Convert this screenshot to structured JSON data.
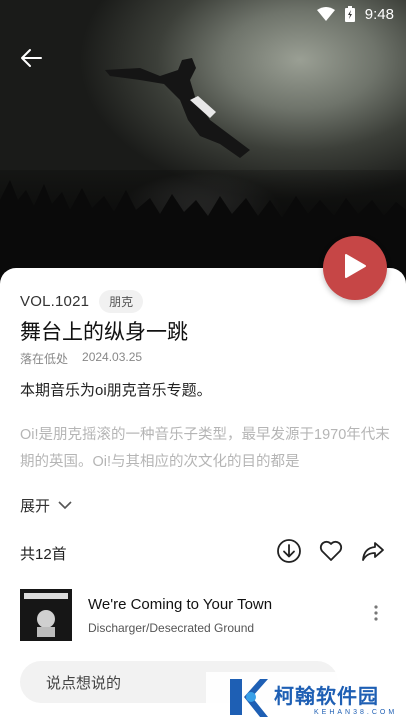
{
  "status_bar": {
    "time": "9:48"
  },
  "episode": {
    "vol": "VOL.1021",
    "tag": "朋克",
    "title": "舞台上的纵身一跳",
    "author": "落在低处",
    "date": "2024.03.25",
    "subtitle": "本期音乐为oi朋克音乐专题。",
    "description": "Oi!是朋克摇滚的一种音乐子类型，最早发源于1970年代末期的英国。Oi!与其相应的次文化的目的都是",
    "expand_label": "展开"
  },
  "tracklist": {
    "count_label": "共12首",
    "tracks": [
      {
        "title": "We're Coming to Your Town",
        "artist": "Discharger/Desecrated Ground"
      }
    ]
  },
  "comment": {
    "placeholder": "说点想说的"
  },
  "watermark": {
    "main": "柯翰软件园",
    "sub": "KEHAN38.COM"
  },
  "colors": {
    "play_button": "#c64646",
    "watermark": "#1e5fb4"
  },
  "icons": [
    "back-arrow-icon",
    "wifi-icon",
    "battery-icon",
    "play-icon",
    "chevron-down-icon",
    "download-icon",
    "heart-icon",
    "share-icon",
    "more-vertical-icon"
  ]
}
